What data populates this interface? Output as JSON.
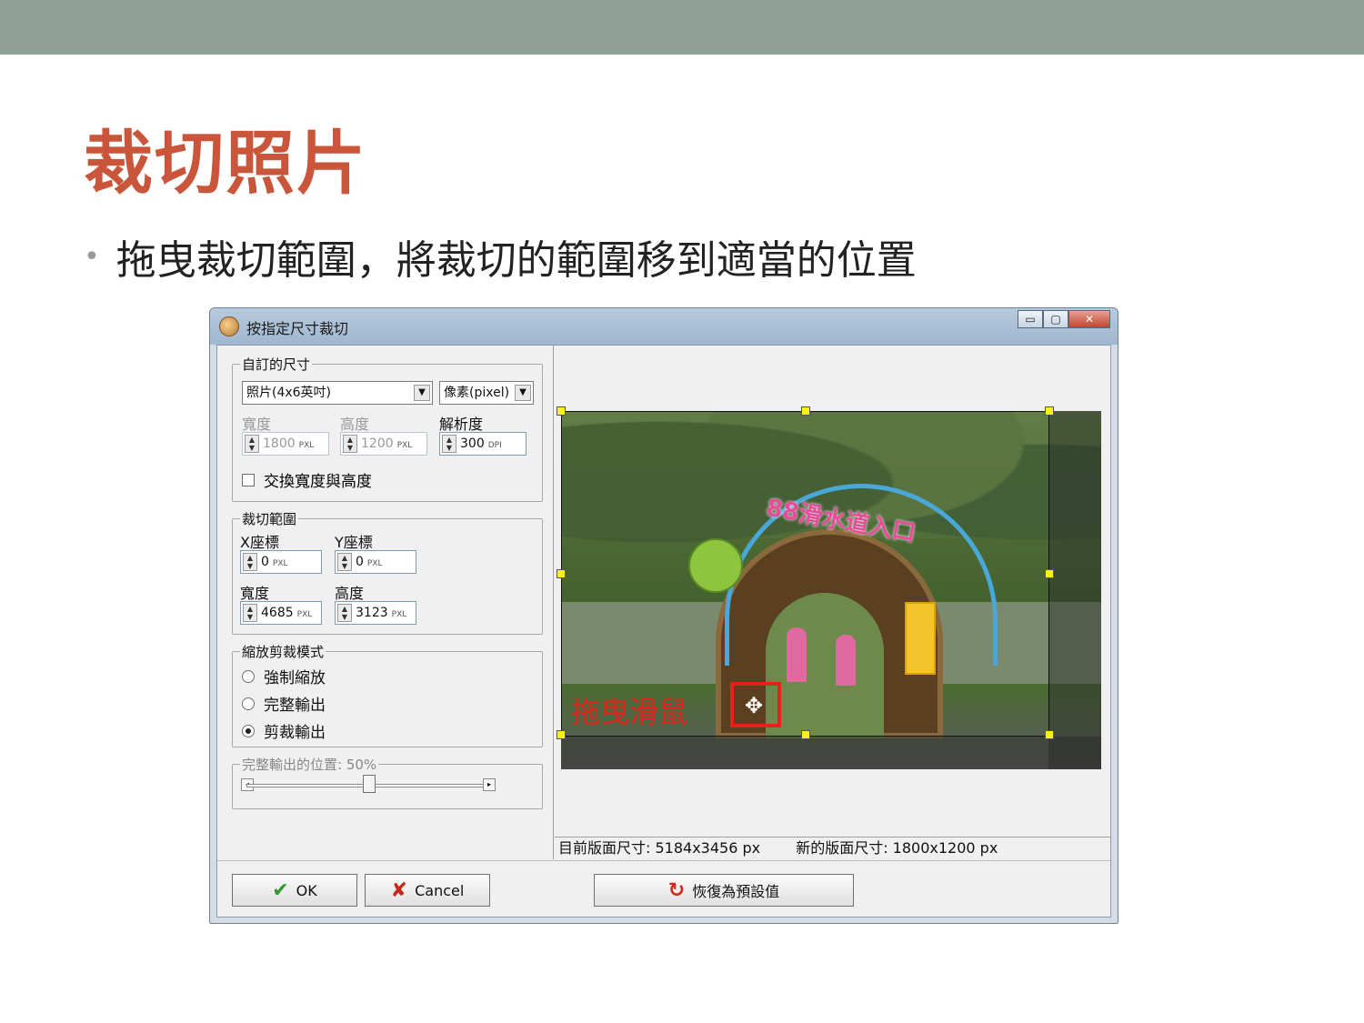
{
  "slide": {
    "title": "裁切照片",
    "bullet": "拖曳裁切範圍，將裁切的範圍移到適當的位置"
  },
  "window": {
    "title": "按指定尺寸裁切",
    "minimize_label": "▭",
    "maximize_label": "▢",
    "close_label": "✕"
  },
  "custom_size": {
    "legend": "自訂的尺寸",
    "preset_value": "照片(4x6英吋)",
    "unit_value": "像素(pixel)",
    "width_label": "寬度",
    "height_label": "高度",
    "dpi_label": "解析度",
    "width_value": "1800",
    "width_unit": "PXL",
    "height_value": "1200",
    "height_unit": "PXL",
    "dpi_value": "300",
    "dpi_unit": "DPI",
    "swap_label": "交換寬度與高度"
  },
  "crop_range": {
    "legend": "裁切範圍",
    "x_label": "X座標",
    "y_label": "Y座標",
    "x_value": "0",
    "y_value": "0",
    "w_label": "寬度",
    "h_label": "高度",
    "w_value": "4685",
    "h_value": "3123",
    "unit": "PXL"
  },
  "scale_mode": {
    "legend": "縮放剪裁模式",
    "options": [
      "強制縮放",
      "完整輸出",
      "剪裁輸出"
    ],
    "selected": "剪裁輸出"
  },
  "output_position": {
    "legend": "完整輸出的位置: 50%",
    "value_percent": 50
  },
  "preview": {
    "arch_text": "88滑水道入口",
    "drag_label": "拖曳滑鼠",
    "move_icon": "move-icon"
  },
  "status": {
    "current": "目前版面尺寸: 5184x3456 px",
    "new": "新的版面尺寸: 1800x1200 px"
  },
  "buttons": {
    "ok": "OK",
    "cancel": "Cancel",
    "reset": "恢復為預設值"
  },
  "colors": {
    "accent": "#c9553a",
    "band": "#8fa096",
    "drag_red": "#e2231a",
    "handle_yellow": "#f7f21a"
  }
}
